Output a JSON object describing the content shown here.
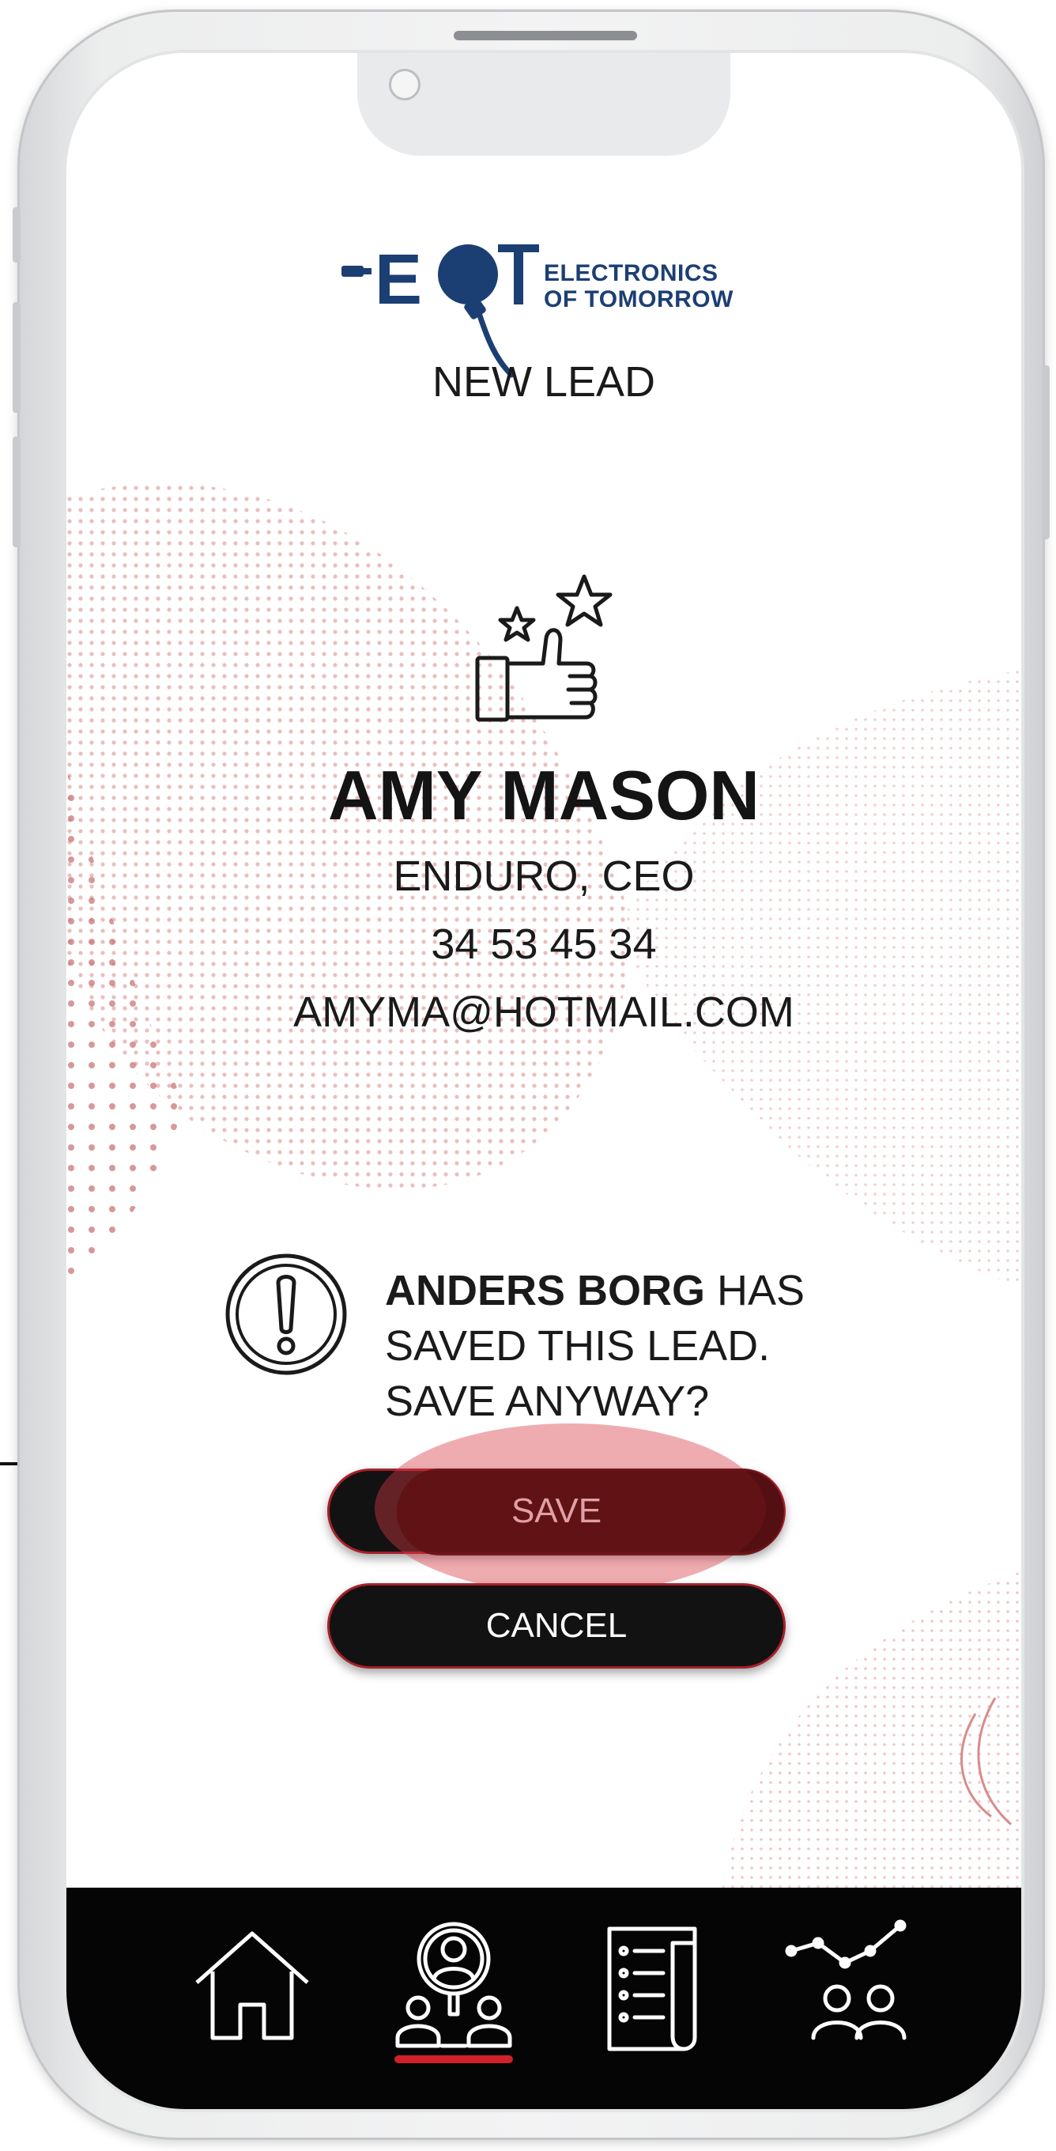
{
  "logo": {
    "brand": "EOT",
    "line1": "ELECTRONICS",
    "line2": "OF TOMORROW"
  },
  "screen_title": "NEW LEAD",
  "contact": {
    "name": "AMY MASON",
    "company_role": "ENDURO, CEO",
    "phone": "34 53 45 34",
    "email": "AMYMA@HOTMAIL.COM"
  },
  "warning": {
    "person": "ANDERS BORG",
    "line1_rest": " HAS",
    "line2": "SAVED THIS LEAD.",
    "line3": "SAVE ANYWAY?"
  },
  "buttons": {
    "save": "SAVE",
    "cancel": "CANCEL"
  },
  "nav": {
    "items": [
      {
        "icon": "home-icon",
        "active": false
      },
      {
        "icon": "leads-scan-icon",
        "active": true
      },
      {
        "icon": "list-document-icon",
        "active": false
      },
      {
        "icon": "analytics-people-icon",
        "active": false
      }
    ],
    "active_color": "#d0202a"
  },
  "colors": {
    "brand_blue": "#1c3f73",
    "accent_red": "#a6202a",
    "button_bg": "#121212",
    "navbar_bg": "#050505"
  }
}
